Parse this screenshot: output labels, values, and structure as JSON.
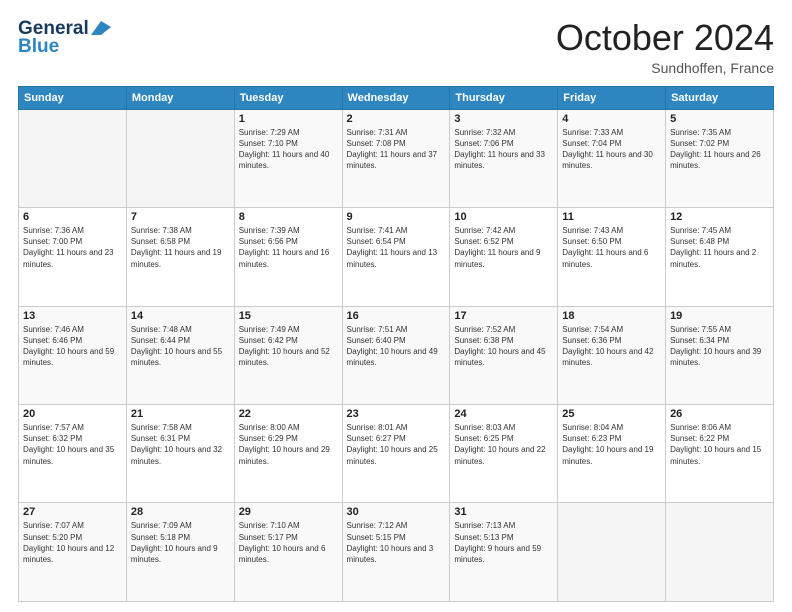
{
  "header": {
    "logo_line1": "General",
    "logo_line2": "Blue",
    "month": "October 2024",
    "location": "Sundhoffen, France"
  },
  "weekdays": [
    "Sunday",
    "Monday",
    "Tuesday",
    "Wednesday",
    "Thursday",
    "Friday",
    "Saturday"
  ],
  "weeks": [
    [
      {
        "day": "",
        "info": ""
      },
      {
        "day": "",
        "info": ""
      },
      {
        "day": "1",
        "info": "Sunrise: 7:29 AM\nSunset: 7:10 PM\nDaylight: 11 hours and 40 minutes."
      },
      {
        "day": "2",
        "info": "Sunrise: 7:31 AM\nSunset: 7:08 PM\nDaylight: 11 hours and 37 minutes."
      },
      {
        "day": "3",
        "info": "Sunrise: 7:32 AM\nSunset: 7:06 PM\nDaylight: 11 hours and 33 minutes."
      },
      {
        "day": "4",
        "info": "Sunrise: 7:33 AM\nSunset: 7:04 PM\nDaylight: 11 hours and 30 minutes."
      },
      {
        "day": "5",
        "info": "Sunrise: 7:35 AM\nSunset: 7:02 PM\nDaylight: 11 hours and 26 minutes."
      }
    ],
    [
      {
        "day": "6",
        "info": "Sunrise: 7:36 AM\nSunset: 7:00 PM\nDaylight: 11 hours and 23 minutes."
      },
      {
        "day": "7",
        "info": "Sunrise: 7:38 AM\nSunset: 6:58 PM\nDaylight: 11 hours and 19 minutes."
      },
      {
        "day": "8",
        "info": "Sunrise: 7:39 AM\nSunset: 6:56 PM\nDaylight: 11 hours and 16 minutes."
      },
      {
        "day": "9",
        "info": "Sunrise: 7:41 AM\nSunset: 6:54 PM\nDaylight: 11 hours and 13 minutes."
      },
      {
        "day": "10",
        "info": "Sunrise: 7:42 AM\nSunset: 6:52 PM\nDaylight: 11 hours and 9 minutes."
      },
      {
        "day": "11",
        "info": "Sunrise: 7:43 AM\nSunset: 6:50 PM\nDaylight: 11 hours and 6 minutes."
      },
      {
        "day": "12",
        "info": "Sunrise: 7:45 AM\nSunset: 6:48 PM\nDaylight: 11 hours and 2 minutes."
      }
    ],
    [
      {
        "day": "13",
        "info": "Sunrise: 7:46 AM\nSunset: 6:46 PM\nDaylight: 10 hours and 59 minutes."
      },
      {
        "day": "14",
        "info": "Sunrise: 7:48 AM\nSunset: 6:44 PM\nDaylight: 10 hours and 55 minutes."
      },
      {
        "day": "15",
        "info": "Sunrise: 7:49 AM\nSunset: 6:42 PM\nDaylight: 10 hours and 52 minutes."
      },
      {
        "day": "16",
        "info": "Sunrise: 7:51 AM\nSunset: 6:40 PM\nDaylight: 10 hours and 49 minutes."
      },
      {
        "day": "17",
        "info": "Sunrise: 7:52 AM\nSunset: 6:38 PM\nDaylight: 10 hours and 45 minutes."
      },
      {
        "day": "18",
        "info": "Sunrise: 7:54 AM\nSunset: 6:36 PM\nDaylight: 10 hours and 42 minutes."
      },
      {
        "day": "19",
        "info": "Sunrise: 7:55 AM\nSunset: 6:34 PM\nDaylight: 10 hours and 39 minutes."
      }
    ],
    [
      {
        "day": "20",
        "info": "Sunrise: 7:57 AM\nSunset: 6:32 PM\nDaylight: 10 hours and 35 minutes."
      },
      {
        "day": "21",
        "info": "Sunrise: 7:58 AM\nSunset: 6:31 PM\nDaylight: 10 hours and 32 minutes."
      },
      {
        "day": "22",
        "info": "Sunrise: 8:00 AM\nSunset: 6:29 PM\nDaylight: 10 hours and 29 minutes."
      },
      {
        "day": "23",
        "info": "Sunrise: 8:01 AM\nSunset: 6:27 PM\nDaylight: 10 hours and 25 minutes."
      },
      {
        "day": "24",
        "info": "Sunrise: 8:03 AM\nSunset: 6:25 PM\nDaylight: 10 hours and 22 minutes."
      },
      {
        "day": "25",
        "info": "Sunrise: 8:04 AM\nSunset: 6:23 PM\nDaylight: 10 hours and 19 minutes."
      },
      {
        "day": "26",
        "info": "Sunrise: 8:06 AM\nSunset: 6:22 PM\nDaylight: 10 hours and 15 minutes."
      }
    ],
    [
      {
        "day": "27",
        "info": "Sunrise: 7:07 AM\nSunset: 5:20 PM\nDaylight: 10 hours and 12 minutes."
      },
      {
        "day": "28",
        "info": "Sunrise: 7:09 AM\nSunset: 5:18 PM\nDaylight: 10 hours and 9 minutes."
      },
      {
        "day": "29",
        "info": "Sunrise: 7:10 AM\nSunset: 5:17 PM\nDaylight: 10 hours and 6 minutes."
      },
      {
        "day": "30",
        "info": "Sunrise: 7:12 AM\nSunset: 5:15 PM\nDaylight: 10 hours and 3 minutes."
      },
      {
        "day": "31",
        "info": "Sunrise: 7:13 AM\nSunset: 5:13 PM\nDaylight: 9 hours and 59 minutes."
      },
      {
        "day": "",
        "info": ""
      },
      {
        "day": "",
        "info": ""
      }
    ]
  ]
}
